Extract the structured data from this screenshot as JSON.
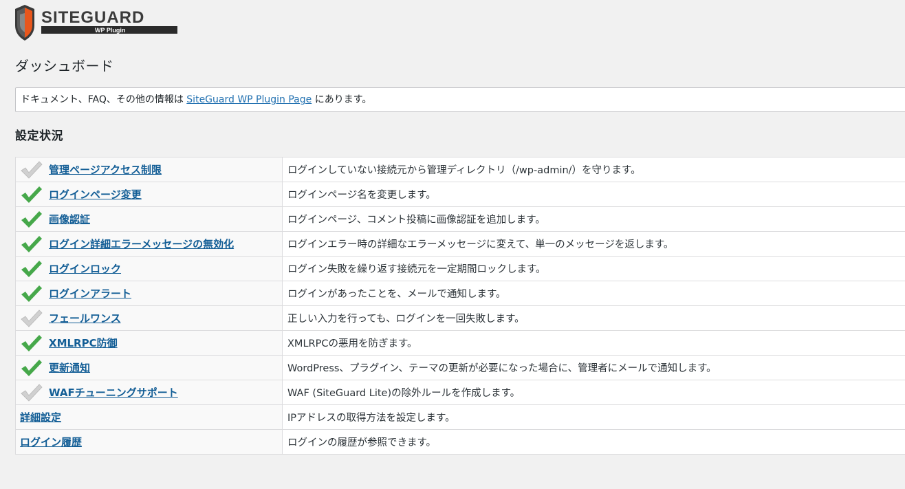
{
  "logo": {
    "brand": "SITEGUARD",
    "sub": "WP Plugin"
  },
  "page": {
    "title": "ダッシュボード"
  },
  "notice": {
    "prefix": "ドキュメント、FAQ、その他の情報は ",
    "link": "SiteGuard WP Plugin Page",
    "suffix": " にあります。"
  },
  "section": {
    "title": "設定状況"
  },
  "colors": {
    "check_on": "#46a84a",
    "check_off": "#d0d0d0",
    "link": "#135e96"
  },
  "features": [
    {
      "name": "管理ページアクセス制限",
      "desc": "ログインしていない接続元から管理ディレクトリ（/wp-admin/）を守ります。",
      "status": "off",
      "icon": "check-off-icon"
    },
    {
      "name": "ログインページ変更",
      "desc": "ログインページ名を変更します。",
      "status": "on",
      "icon": "check-on-icon"
    },
    {
      "name": "画像認証",
      "desc": "ログインページ、コメント投稿に画像認証を追加します。",
      "status": "on",
      "icon": "check-on-icon"
    },
    {
      "name": "ログイン詳細エラーメッセージの無効化",
      "desc": "ログインエラー時の詳細なエラーメッセージに変えて、単一のメッセージを返します。",
      "status": "on",
      "icon": "check-on-icon"
    },
    {
      "name": "ログインロック",
      "desc": "ログイン失敗を繰り返す接続元を一定期間ロックします。",
      "status": "on",
      "icon": "check-on-icon"
    },
    {
      "name": "ログインアラート",
      "desc": "ログインがあったことを、メールで通知します。",
      "status": "on",
      "icon": "check-on-icon"
    },
    {
      "name": "フェールワンス",
      "desc": "正しい入力を行っても、ログインを一回失敗します。",
      "status": "off",
      "icon": "check-off-icon"
    },
    {
      "name": "XMLRPC防御",
      "desc": "XMLRPCの悪用を防ぎます。",
      "status": "on",
      "icon": "check-on-icon"
    },
    {
      "name": "更新通知",
      "desc": "WordPress、プラグイン、テーマの更新が必要になった場合に、管理者にメールで通知します。",
      "status": "on",
      "icon": "check-on-icon"
    },
    {
      "name": "WAFチューニングサポート",
      "desc": "WAF (SiteGuard Lite)の除外ルールを作成します。",
      "status": "off",
      "icon": "check-off-icon"
    },
    {
      "name": "詳細設定",
      "desc": "IPアドレスの取得方法を設定します。",
      "status": "none"
    },
    {
      "name": "ログイン履歴",
      "desc": "ログインの履歴が参照できます。",
      "status": "none"
    }
  ]
}
